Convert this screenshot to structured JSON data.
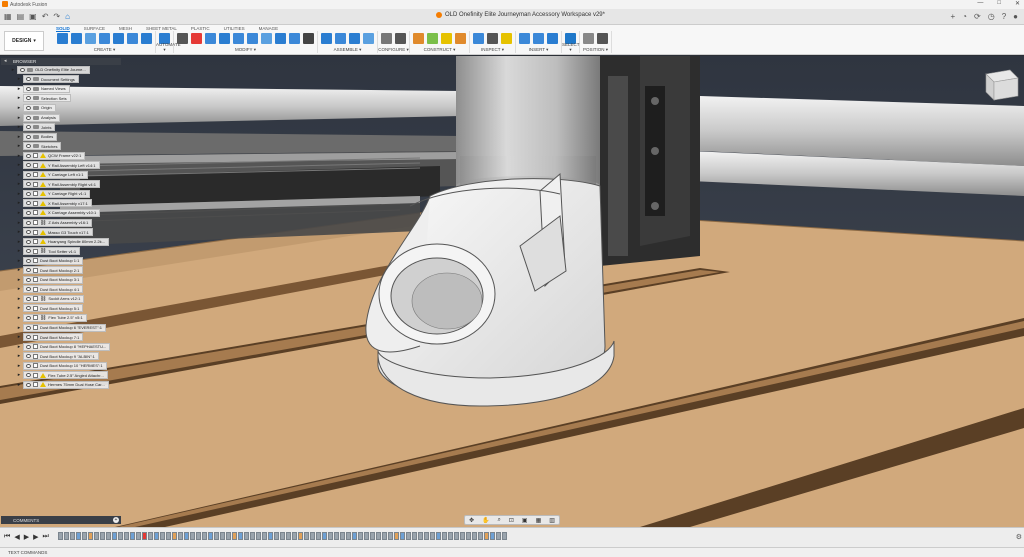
{
  "window": {
    "app_title": "Autodesk Fusion",
    "minimize": "—",
    "maximize": "□",
    "close": "✕"
  },
  "document_tab": {
    "title": "OLD Onefinity Elite Journeyman Accessory Workspace v29*"
  },
  "workspace": {
    "label": "DESIGN"
  },
  "ribbon_tabs": [
    "SOLID",
    "SURFACE",
    "MESH",
    "SHEET METAL",
    "PLASTIC",
    "UTILITIES",
    "MANAGE"
  ],
  "ribbon_groups": [
    {
      "label": "CREATE ▾",
      "icons": [
        "#2a7dd1",
        "#2a7dd1",
        "#5aa0e0",
        "#3b88d8",
        "#2a7dd1",
        "#3b88d8",
        "#2a7dd1"
      ]
    },
    {
      "label": "AUTOMATE ▾",
      "icons": [
        "#2a7dd1"
      ]
    },
    {
      "label": "MODIFY ▾",
      "icons": [
        "#555555",
        "#e53935",
        "#3b88d8",
        "#2a7dd1",
        "#3b88d8",
        "#3b88d8",
        "#5aa0e0",
        "#2a7dd1",
        "#3b88d8",
        "#444444"
      ]
    },
    {
      "label": "ASSEMBLE ▾",
      "icons": [
        "#2a7dd1",
        "#3b88d8",
        "#2a7dd1",
        "#5aa0e0"
      ]
    },
    {
      "label": "CONFIGURE ▾",
      "icons": [
        "#777777",
        "#555555"
      ]
    },
    {
      "label": "CONSTRUCT ▾",
      "icons": [
        "#e08a2c",
        "#7bbf4a",
        "#e6c200",
        "#e08a2c"
      ]
    },
    {
      "label": "INSPECT ▾",
      "icons": [
        "#3b88d8",
        "#555555",
        "#e6c200"
      ]
    },
    {
      "label": "INSERT ▾",
      "icons": [
        "#3b88d8",
        "#3b88d8",
        "#2a7dd1"
      ]
    },
    {
      "label": "SELECT ▾",
      "icons": [
        "#1f78c9"
      ]
    },
    {
      "label": "POSITION ▾",
      "icons": [
        "#888888",
        "#555555"
      ]
    }
  ],
  "browser": {
    "title": "BROWSER",
    "rows": [
      {
        "label": "OLD Onefinity Elite Journe...",
        "level": 0,
        "type": "root"
      },
      {
        "label": "Document Settings",
        "level": 1,
        "type": "folder"
      },
      {
        "label": "Named Views",
        "level": 1,
        "type": "folder"
      },
      {
        "label": "Selection Sets",
        "level": 1,
        "type": "folder"
      },
      {
        "label": "Origin",
        "level": 1,
        "type": "folder"
      },
      {
        "label": "Analysis",
        "level": 1,
        "type": "folder"
      },
      {
        "label": "Joints",
        "level": 1,
        "type": "folder"
      },
      {
        "label": "Bodies",
        "level": 1,
        "type": "folder"
      },
      {
        "label": "Sketches",
        "level": 1,
        "type": "folder"
      },
      {
        "label": "QCW Frame v22:1",
        "level": 1,
        "type": "warn"
      },
      {
        "label": "Y Rail Assembly Left v14:1",
        "level": 1,
        "type": "warn"
      },
      {
        "label": "Y Carriage Left v1:1",
        "level": 1,
        "type": "warn"
      },
      {
        "label": "Y Rail Assembly Right v4:1",
        "level": 1,
        "type": "warn"
      },
      {
        "label": "Y Carriage Right v1:1",
        "level": 1,
        "type": "warn"
      },
      {
        "label": "X Rail Assembly v17:1",
        "level": 1,
        "type": "warn"
      },
      {
        "label": "X Carriage Assembly v10:1",
        "level": 1,
        "type": "warn"
      },
      {
        "label": "Z Axis Assembly v16:1",
        "level": 1,
        "type": "link"
      },
      {
        "label": "Masso G3 Touch v17:1",
        "level": 1,
        "type": "warn"
      },
      {
        "label": "Huanyang Spindle 80mm 2.2k...",
        "level": 1,
        "type": "warn"
      },
      {
        "label": "Tool Setter v1:1",
        "level": 1,
        "type": "link"
      },
      {
        "label": "Dust Boot Mockup 1:1",
        "level": 1,
        "type": "comp"
      },
      {
        "label": "Dust Boot Mockup 2:1",
        "level": 1,
        "type": "comp"
      },
      {
        "label": "Dust Boot Mockup 3:1",
        "level": 1,
        "type": "comp"
      },
      {
        "label": "Dust Boot Mockup 4:1",
        "level": 1,
        "type": "comp"
      },
      {
        "label": "Suckit Arms v12:1",
        "level": 1,
        "type": "link"
      },
      {
        "label": "Dust Boot Mockup 5:1",
        "level": 1,
        "type": "comp"
      },
      {
        "label": "Flex Tube 2.5\" v5:1",
        "level": 1,
        "type": "link"
      },
      {
        "label": "Dust Boot Mockup 6 \"EVEREST\":1",
        "level": 1,
        "type": "comp"
      },
      {
        "label": "Dust Boot Mockup 7:1",
        "level": 1,
        "type": "comp"
      },
      {
        "label": "Dust Boot Mockup 8 \"HEPHAESTU...",
        "level": 1,
        "type": "comp"
      },
      {
        "label": "Dust Boot Mockup 9 \"ALBIN\":1",
        "level": 1,
        "type": "comp"
      },
      {
        "label": "Dust Boot Mockup 10 \"HERMES\":1",
        "level": 1,
        "type": "comp"
      },
      {
        "label": "Flex Tube 2.5\" Angled Attachr...",
        "level": 1,
        "type": "warn"
      },
      {
        "label": "Hermes 75mm Dual Hose Car...",
        "level": 1,
        "type": "warn"
      }
    ]
  },
  "comments": {
    "title": "COMMENTS"
  },
  "nav_toolbar": {
    "icons": [
      "orbit-icon",
      "pan-icon",
      "zoom-icon",
      "fit-icon",
      "display-icon",
      "grid-icon",
      "viewports-icon"
    ]
  },
  "timeline": {
    "controls": [
      "⏮",
      "◀",
      "▶",
      "▶",
      "⏭"
    ]
  },
  "status": {
    "label": "TEXT COMMANDS"
  }
}
